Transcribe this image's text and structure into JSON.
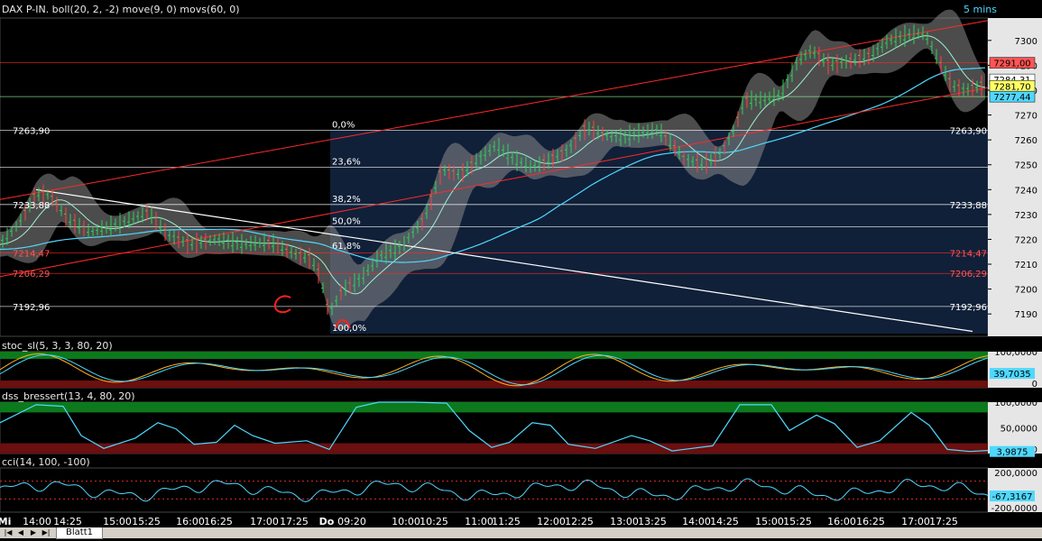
{
  "window": {
    "timeframe": "5 mins",
    "sheet_tab": "Blatt1"
  },
  "colors": {
    "background": "#000000",
    "price_line": "#2fd15a",
    "bollinger_band": "#8a8a8a",
    "move_ma": "#9ff0d0",
    "movs_ma": "#4fd8ff",
    "trend_red": "#ff2a2a",
    "trend_white": "#ffffff",
    "fib_zone": "#1e3a66",
    "osc_green": "#0c7a1c",
    "osc_red": "#6b0f0f",
    "cci_line": "#4fd8ff"
  },
  "chart_data": [
    {
      "type": "line",
      "title": "DAX P-IN. boll(20, 2, -2) move(9, 0) movs(60, 0)",
      "ylim": [
        7181,
        7309
      ],
      "y_ticks": [
        7190,
        7200,
        7210,
        7220,
        7230,
        7240,
        7250,
        7260,
        7270,
        7280,
        7290,
        7300
      ],
      "x_ticks": [
        "Mi",
        "14:00",
        "14:25",
        "15:00",
        "15:25",
        "16:00",
        "16:25",
        "17:00",
        "17:25",
        "Do",
        "09:20",
        "10:00",
        "10:25",
        "11:00",
        "11:25",
        "12:00",
        "12:25",
        "13:00",
        "13:25",
        "14:00",
        "14:25",
        "15:00",
        "15:25",
        "16:00",
        "16:25",
        "17:00",
        "17:25"
      ],
      "price_path": [
        [
          0,
          7218
        ],
        [
          20,
          7226
        ],
        [
          40,
          7238
        ],
        [
          55,
          7238
        ],
        [
          75,
          7228
        ],
        [
          100,
          7223
        ],
        [
          130,
          7226
        ],
        [
          165,
          7231
        ],
        [
          185,
          7222
        ],
        [
          210,
          7218
        ],
        [
          240,
          7220
        ],
        [
          270,
          7218
        ],
        [
          300,
          7219
        ],
        [
          320,
          7215
        ],
        [
          345,
          7212
        ],
        [
          355,
          7205
        ],
        [
          365,
          7190
        ],
        [
          380,
          7200
        ],
        [
          400,
          7204
        ],
        [
          420,
          7213
        ],
        [
          445,
          7217
        ],
        [
          470,
          7228
        ],
        [
          490,
          7248
        ],
        [
          510,
          7246
        ],
        [
          530,
          7252
        ],
        [
          550,
          7258
        ],
        [
          570,
          7252
        ],
        [
          590,
          7249
        ],
        [
          610,
          7252
        ],
        [
          630,
          7256
        ],
        [
          650,
          7265
        ],
        [
          670,
          7262
        ],
        [
          690,
          7261
        ],
        [
          710,
          7263
        ],
        [
          730,
          7264
        ],
        [
          745,
          7258
        ],
        [
          760,
          7252
        ],
        [
          780,
          7250
        ],
        [
          800,
          7255
        ],
        [
          815,
          7265
        ],
        [
          825,
          7276
        ],
        [
          845,
          7276
        ],
        [
          865,
          7278
        ],
        [
          885,
          7292
        ],
        [
          900,
          7296
        ],
        [
          920,
          7290
        ],
        [
          945,
          7292
        ],
        [
          965,
          7294
        ],
        [
          985,
          7300
        ],
        [
          1005,
          7302
        ],
        [
          1025,
          7303
        ],
        [
          1040,
          7292
        ],
        [
          1055,
          7282
        ],
        [
          1070,
          7280
        ],
        [
          1090,
          7282
        ]
      ],
      "price_labels": [
        {
          "value": "7291,00",
          "price": 7291,
          "side": "right",
          "color": "#ff5555"
        },
        {
          "value": "7284,31",
          "price": 7284.3,
          "side": "right",
          "color": "#ffffff"
        },
        {
          "value": "7281,70",
          "price": 7281.7,
          "side": "right",
          "color": "#ffff66"
        },
        {
          "value": "7277,44",
          "price": 7277.4,
          "side": "right",
          "color": "#4fd8ff"
        },
        {
          "value": "7263,90",
          "price": 7263.9,
          "side": "both",
          "color": "#ffffff"
        },
        {
          "value": "7233,88",
          "price": 7233.9,
          "side": "both",
          "color": "#ffffff"
        },
        {
          "value": "7214,47",
          "price": 7214.5,
          "side": "both",
          "color": "#ff5555"
        },
        {
          "value": "7206,29",
          "price": 7206.3,
          "side": "both",
          "color": "#ff5555"
        },
        {
          "value": "7192,96",
          "price": 7193,
          "side": "both",
          "color": "#ffffff"
        }
      ],
      "fibonacci": [
        {
          "label": "0,0%",
          "price": 7263.9
        },
        {
          "label": "23,6%",
          "price": 7249
        },
        {
          "label": "38,2%",
          "price": 7234
        },
        {
          "label": "50,0%",
          "price": 7225
        },
        {
          "label": "61,8%",
          "price": 7215
        },
        {
          "label": "100,0%",
          "price": 7182
        }
      ]
    },
    {
      "type": "line",
      "title": "stoc_sl(5, 3, 3, 80, 20)",
      "ylim": [
        0,
        100
      ],
      "y_ticks": [
        "100,0000",
        "0"
      ],
      "last_value": "39,7035",
      "upper_level": 80,
      "lower_level": 20
    },
    {
      "type": "line",
      "title": "dss_bressert(13, 4, 80, 20)",
      "ylim": [
        0,
        100
      ],
      "y_ticks": [
        "100,0000",
        "50,0000",
        "0"
      ],
      "last_value": "3,9875",
      "upper_level": 80,
      "lower_level": 20,
      "series": [
        {
          "values": [
            [
              0,
              60
            ],
            [
              40,
              95
            ],
            [
              70,
              92
            ],
            [
              90,
              35
            ],
            [
              115,
              10
            ],
            [
              150,
              30
            ],
            [
              175,
              60
            ],
            [
              195,
              48
            ],
            [
              215,
              18
            ],
            [
              240,
              22
            ],
            [
              260,
              55
            ],
            [
              280,
              35
            ],
            [
              305,
              20
            ],
            [
              340,
              25
            ],
            [
              365,
              8
            ],
            [
              395,
              90
            ],
            [
              420,
              100
            ],
            [
              460,
              100
            ],
            [
              495,
              98
            ],
            [
              520,
              45
            ],
            [
              545,
              12
            ],
            [
              565,
              22
            ],
            [
              590,
              60
            ],
            [
              610,
              55
            ],
            [
              630,
              18
            ],
            [
              660,
              10
            ],
            [
              700,
              35
            ],
            [
              720,
              25
            ],
            [
              745,
              5
            ],
            [
              790,
              15
            ],
            [
              820,
              95
            ],
            [
              855,
              95
            ],
            [
              875,
              45
            ],
            [
              905,
              75
            ],
            [
              925,
              58
            ],
            [
              950,
              12
            ],
            [
              975,
              25
            ],
            [
              1010,
              80
            ],
            [
              1030,
              55
            ],
            [
              1050,
              8
            ],
            [
              1075,
              4
            ],
            [
              1095,
              6
            ]
          ]
        }
      ]
    },
    {
      "type": "line",
      "title": "cci(14, 100, -100)",
      "ylim": [
        -250,
        250
      ],
      "y_ticks": [
        "200,0000",
        "-200,0000"
      ],
      "last_value": "-67,3167"
    }
  ]
}
